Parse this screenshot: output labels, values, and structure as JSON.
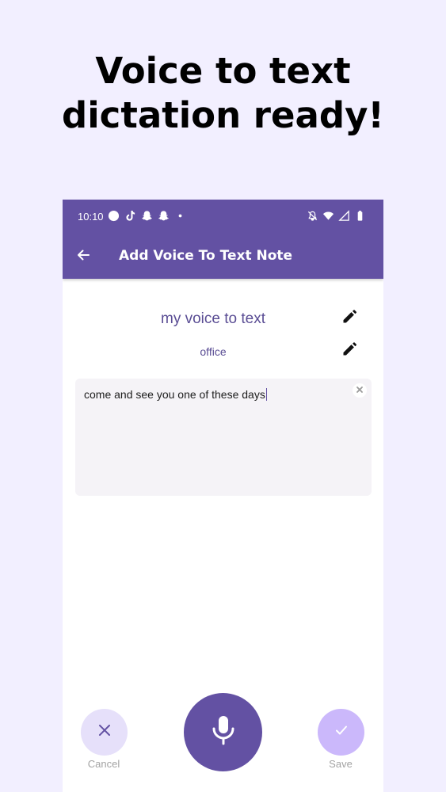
{
  "headline": {
    "line1": "Voice to text",
    "line2": "dictation ready!"
  },
  "status_bar": {
    "time": "10:10",
    "left_icons": [
      "circle-icon",
      "tiktok-icon",
      "snapchat-icon",
      "snapchat-icon",
      "dot-icon"
    ],
    "right_icons": [
      "bell-off-icon",
      "wifi-icon",
      "signal-icon",
      "battery-icon"
    ]
  },
  "app_bar": {
    "title": "Add Voice To Text Note",
    "back_icon": "arrow-left-icon"
  },
  "note": {
    "title": "my voice to text",
    "category": "office",
    "text": "come and see you one of these days"
  },
  "actions": {
    "cancel_label": "Cancel",
    "save_label": "Save",
    "mic_icon": "microphone-icon"
  },
  "colors": {
    "background": "#f2efff",
    "primary": "#6351a3",
    "cancel_bg": "#e6e0fa",
    "save_bg": "#cbb8fb",
    "text_accent": "#5a4d94"
  }
}
